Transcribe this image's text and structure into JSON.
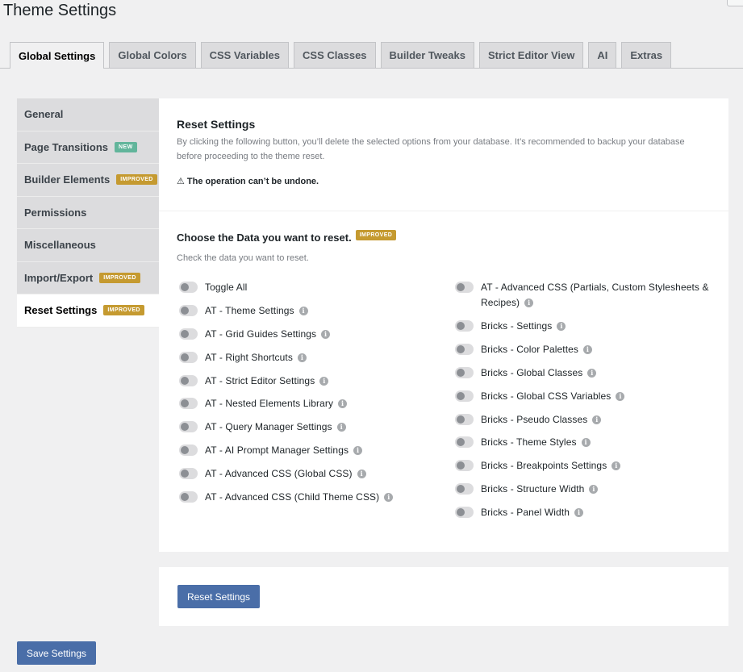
{
  "page_title": "Theme Settings",
  "tabs": [
    {
      "label": "Global Settings",
      "active": true
    },
    {
      "label": "Global Colors"
    },
    {
      "label": "CSS Variables"
    },
    {
      "label": "CSS Classes"
    },
    {
      "label": "Builder Tweaks"
    },
    {
      "label": "Strict Editor View"
    },
    {
      "label": "AI"
    },
    {
      "label": "Extras"
    }
  ],
  "sidebar": {
    "items": [
      {
        "label": "General"
      },
      {
        "label": "Page Transitions",
        "badge": "NEW"
      },
      {
        "label": "Builder Elements",
        "badge": "IMPROVED"
      },
      {
        "label": "Permissions"
      },
      {
        "label": "Miscellaneous"
      },
      {
        "label": "Import/Export",
        "badge": "IMPROVED"
      },
      {
        "label": "Reset Settings",
        "badge": "IMPROVED",
        "active": true
      }
    ]
  },
  "reset": {
    "title": "Reset Settings",
    "description": "By clicking the following button, you’ll delete the selected options from your database. It’s recommended to backup your database before proceeding to the theme reset.",
    "warning": "⚠ The operation can’t be undone."
  },
  "choose": {
    "title": "Choose the Data you want to reset.",
    "badge": "IMPROVED",
    "subtitle": "Check the data you want to reset.",
    "left_options": [
      {
        "label": "Toggle All",
        "info": false
      },
      {
        "label": "AT - Theme Settings",
        "info": true
      },
      {
        "label": "AT - Grid Guides Settings",
        "info": true
      },
      {
        "label": "AT - Right Shortcuts",
        "info": true
      },
      {
        "label": "AT - Strict Editor Settings",
        "info": true
      },
      {
        "label": "AT - Nested Elements Library",
        "info": true
      },
      {
        "label": "AT - Query Manager Settings",
        "info": true
      },
      {
        "label": "AT - AI Prompt Manager Settings",
        "info": true
      },
      {
        "label": "AT - Advanced CSS (Global CSS)",
        "info": true
      },
      {
        "label": "AT - Advanced CSS (Child Theme CSS)",
        "info": true
      }
    ],
    "right_options": [
      {
        "label": "AT - Advanced CSS (Partials, Custom Stylesheets & Recipes)",
        "info": true
      },
      {
        "label": "Bricks - Settings",
        "info": true
      },
      {
        "label": "Bricks - Color Palettes",
        "info": true
      },
      {
        "label": "Bricks - Global Classes",
        "info": true
      },
      {
        "label": "Bricks - Global CSS Variables",
        "info": true
      },
      {
        "label": "Bricks - Pseudo Classes",
        "info": true
      },
      {
        "label": "Bricks - Theme Styles",
        "info": true
      },
      {
        "label": "Bricks - Breakpoints Settings",
        "info": true
      },
      {
        "label": "Bricks - Structure Width",
        "info": true
      },
      {
        "label": "Bricks - Panel Width",
        "info": true
      }
    ]
  },
  "reset_button_label": "Reset Settings",
  "save_button_label": "Save Settings",
  "colors": {
    "accent": "#4a6ea8",
    "badge_new": "#62b59b",
    "badge_improved": "#c59a30"
  }
}
